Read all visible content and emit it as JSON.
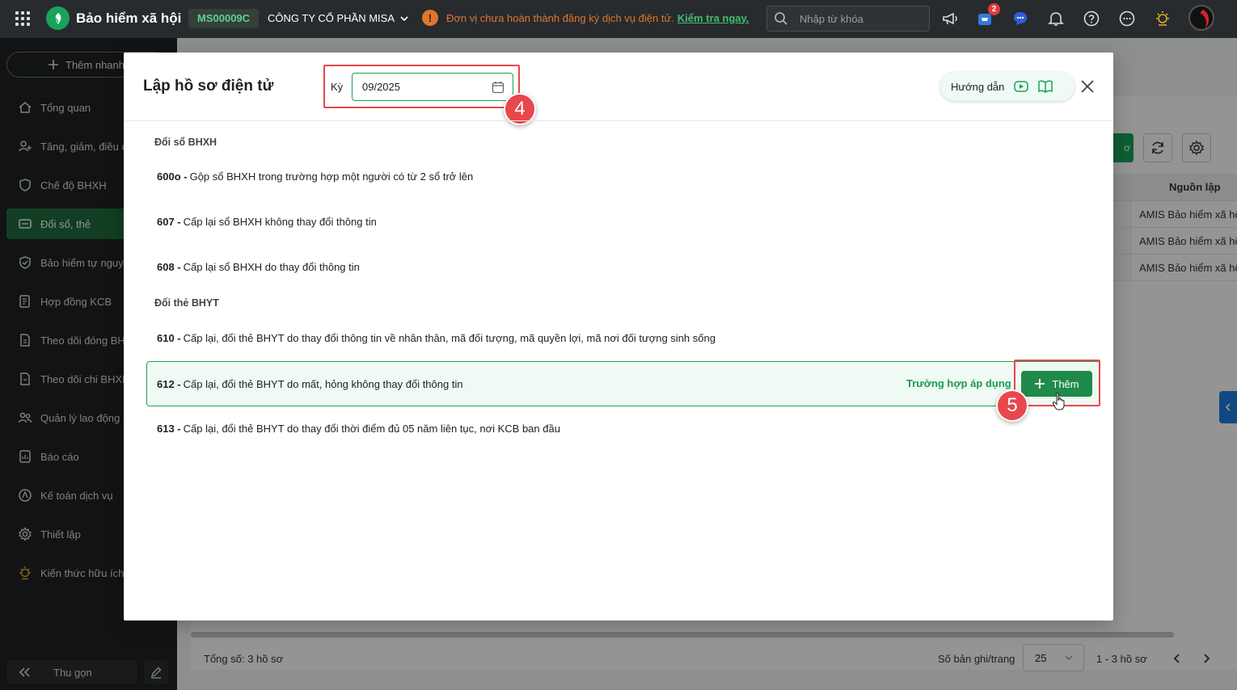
{
  "topbar": {
    "brand": "Bảo hiểm xã hội",
    "unit_code": "MS00009C",
    "company": "CÔNG TY CỔ PHẦN MISA",
    "warning_text": "Đơn vị chưa hoàn thành đăng ký dịch vụ điện tử.",
    "warning_link": "Kiểm tra ngay.",
    "search_placeholder": "Nhập từ khóa",
    "cart_badge": "2"
  },
  "sidebar": {
    "quick_add": "Thêm nhanh",
    "items": [
      {
        "label": "Tổng quan",
        "icon": "home-icon"
      },
      {
        "label": "Tăng, giảm, điều chỉnh",
        "icon": "user-change-icon"
      },
      {
        "label": "Chế độ BHXH",
        "icon": "shield-heart-icon"
      },
      {
        "label": "Đổi sổ, thẻ",
        "icon": "card-swap-icon"
      },
      {
        "label": "Bảo hiểm tự nguyện",
        "icon": "shield-icon"
      },
      {
        "label": "Hợp đồng KCB",
        "icon": "contract-icon"
      },
      {
        "label": "Theo dõi đóng BHXH",
        "icon": "doc-track-icon"
      },
      {
        "label": "Theo dõi chi BHXH",
        "icon": "doc-pay-icon"
      },
      {
        "label": "Quản lý lao động",
        "icon": "users-icon"
      },
      {
        "label": "Báo cáo",
        "icon": "report-icon"
      },
      {
        "label": "Kế toán dịch vụ",
        "icon": "accounting-icon"
      },
      {
        "label": "Thiết lập",
        "icon": "gear-icon"
      },
      {
        "label": "Kiến thức hữu ích",
        "icon": "lightbulb-icon"
      }
    ],
    "active_index": 3,
    "collapse": "Thu gọn"
  },
  "background": {
    "column_header": "Nguồn lập",
    "rows": [
      "AMIS Bảo hiểm xã hội",
      "AMIS Bảo hiểm xã hội",
      "AMIS Bảo hiểm xã hội"
    ],
    "partial_button": "ơ",
    "total": "Tổng số: 3 hồ sơ",
    "per_page_label": "Số bản ghi/trang",
    "per_page": "25",
    "range": "1 - 3 hồ sơ"
  },
  "modal": {
    "title": "Lập hồ sơ điện tử",
    "period_label": "Kỳ",
    "period_value": "09/2025",
    "guide_label": "Hướng dẫn",
    "groups": [
      {
        "title": "Đổi sổ BHXH",
        "items": [
          {
            "code": "600o -",
            "text": "Gộp sổ BHXH trong trường hợp một người có từ 2 sổ trở lên"
          },
          {
            "code": "607 -",
            "text": "Cấp lại sổ BHXH không thay đổi thông tin"
          },
          {
            "code": "608 -",
            "text": "Cấp lại sổ BHXH do thay đổi thông tin"
          }
        ]
      },
      {
        "title": "Đổi thẻ BHYT",
        "items": [
          {
            "code": "610 -",
            "text": "Cấp lại, đổi thẻ BHYT do thay đổi thông tin về nhân thân, mã đối tượng, mã quyền lợi, mã nơi đối tượng sinh sống"
          },
          {
            "code": "612 -",
            "text": "Cấp lại, đổi thẻ BHYT do mất, hỏng không thay đổi thông tin"
          },
          {
            "code": "613 -",
            "text": "Cấp lại, đổi thẻ BHYT do thay đổi thời điểm đủ 05 năm liên tục, nơi KCB ban đầu"
          }
        ]
      }
    ],
    "apply_link": "Trường hợp áp dụng",
    "add_button": "Thêm",
    "step_period": "4",
    "step_add": "5"
  },
  "colors": {
    "accent_green": "#1aa35a",
    "button_green": "#1f8a4a",
    "highlight_red": "#e8474c",
    "warning_orange": "#e0762b"
  }
}
